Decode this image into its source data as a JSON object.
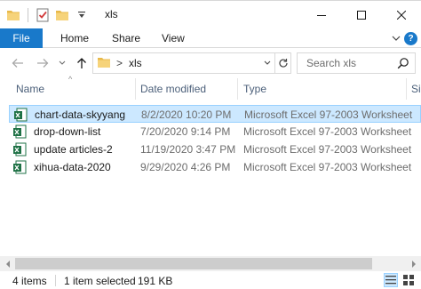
{
  "window": {
    "title": "xls"
  },
  "ribbon": {
    "tabs": [
      "File",
      "Home",
      "Share",
      "View"
    ]
  },
  "address": {
    "separator": ">",
    "path": "xls"
  },
  "search": {
    "placeholder": "Search xls"
  },
  "columns": {
    "name": "Name",
    "date": "Date modified",
    "type": "Type",
    "size": "Si"
  },
  "files": [
    {
      "name": "chart-data-skyyang",
      "date": "8/2/2020 10:20 PM",
      "type": "Microsoft Excel 97-2003 Worksheet",
      "selected": true
    },
    {
      "name": "drop-down-list",
      "date": "7/20/2020 9:14 PM",
      "type": "Microsoft Excel 97-2003 Worksheet",
      "selected": false
    },
    {
      "name": "update articles-2",
      "date": "11/19/2020 3:47 PM",
      "type": "Microsoft Excel 97-2003 Worksheet",
      "selected": false
    },
    {
      "name": "xihua-data-2020",
      "date": "9/29/2020 4:26 PM",
      "type": "Microsoft Excel 97-2003 Worksheet",
      "selected": false
    }
  ],
  "status": {
    "item_count": "4 items",
    "selected": "1 item selected",
    "size": "191 KB"
  },
  "colors": {
    "accent": "#1979ca",
    "selection": "#cce8ff",
    "excel_green": "#1e7145"
  },
  "icons": {
    "file": "excel-file-icon",
    "folder": "folder-icon"
  }
}
